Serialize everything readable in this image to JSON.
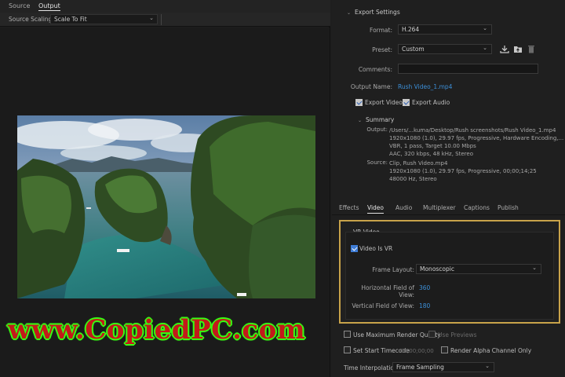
{
  "left": {
    "tabs": [
      "Source",
      "Output"
    ],
    "active_tab": "Output",
    "source_scaling": {
      "label": "Source Scaling:",
      "value": "Scale To Fit"
    }
  },
  "export_settings": {
    "title": "Export Settings",
    "format": {
      "label": "Format:",
      "value": "H.264"
    },
    "preset": {
      "label": "Preset:",
      "value": "Custom"
    },
    "comments": {
      "label": "Comments:",
      "value": ""
    },
    "output_name": {
      "label": "Output Name:",
      "value": "Rush Video_1.mp4"
    },
    "export_video": {
      "label": "Export Video",
      "checked": true
    },
    "export_audio": {
      "label": "Export Audio",
      "checked": true
    },
    "summary": {
      "title": "Summary",
      "output_label": "Output:",
      "output_lines": [
        "/Users/...kuma/Desktop/Rush screenshots/Rush Video_1.mp4",
        "1920x1080 (1.0), 29.97 fps, Progressive, Hardware Encoding,...",
        "VBR, 1 pass, Target 10.00 Mbps",
        "AAC, 320 kbps, 48 kHz, Stereo"
      ],
      "source_label": "Source:",
      "source_lines": [
        "Clip, Rush Video.mp4",
        "1920x1080 (1.0), 29.97 fps, Progressive, 00;00;14;25",
        "48000 Hz, Stereo"
      ]
    }
  },
  "tabs": [
    "Effects",
    "Video",
    "Audio",
    "Multiplexer",
    "Captions",
    "Publish"
  ],
  "active_tab": "Video",
  "vr_video": {
    "title": "VR Video",
    "video_is_vr": {
      "label": "Video Is VR",
      "checked": true
    },
    "frame_layout": {
      "label": "Frame Layout:",
      "value": "Monoscopic"
    },
    "horizontal_fov": {
      "label": "Horizontal Field of View:",
      "value": "360"
    },
    "vertical_fov": {
      "label": "Vertical Field of View:",
      "value": "180"
    }
  },
  "bottom": {
    "max_render_quality": {
      "label": "Use Maximum Render Quality",
      "checked": false
    },
    "use_previews": {
      "label": "Use Previews",
      "checked": false
    },
    "set_start_timecode": {
      "label": "Set Start Timecode",
      "checked": false,
      "value": "00;00;00;00"
    },
    "render_alpha": {
      "label": "Render Alpha Channel Only",
      "checked": false
    },
    "time_interpolation": {
      "label": "Time Interpolation:",
      "value": "Frame Sampling"
    }
  },
  "watermark": "www.CopiedPC.com",
  "colors": {
    "accent": "#3c8fd8",
    "highlight_box": "#c8a34a",
    "watermark_fill": "#c21a1a",
    "watermark_outline": "#39ff14"
  }
}
